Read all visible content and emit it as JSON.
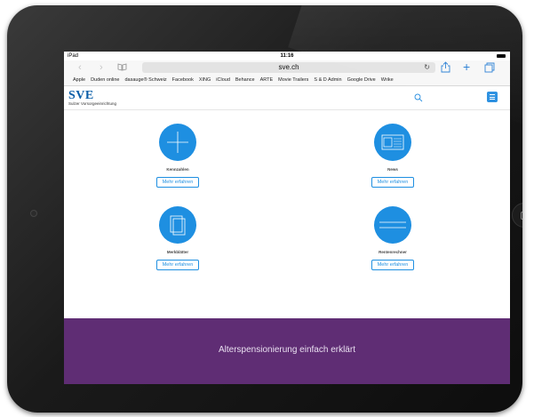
{
  "status_bar": {
    "device": "iPad",
    "time": "11:16"
  },
  "browser": {
    "url": "sve.ch",
    "favorites": [
      "Apple",
      "Duden online",
      "dasauge® Schweiz",
      "Facebook",
      "XING",
      "iCloud",
      "Behance",
      "ARTE",
      "Movie Trailers",
      "S & D Admin",
      "Google Drive",
      "Wrike"
    ]
  },
  "site": {
    "logo": "SVE",
    "logo_subtitle": "Sulzer Vorsorgeeinrichtung"
  },
  "tiles": [
    {
      "label": "Kennzahlen",
      "button": "Mehr erfahren",
      "icon": "plus-icon"
    },
    {
      "label": "News",
      "button": "Mehr erfahren",
      "icon": "news-icon"
    },
    {
      "label": "Merkblätter",
      "button": "Mehr erfahren",
      "icon": "documents-icon"
    },
    {
      "label": "Rentenrechner",
      "button": "Mehr erfahren",
      "icon": "calculator-icon"
    }
  ],
  "banner": {
    "text": "Alterspensionierung einfach erklärt"
  },
  "colors": {
    "accent": "#1e8fe1",
    "logo": "#0b5ea8",
    "banner": "#5f2d74"
  }
}
